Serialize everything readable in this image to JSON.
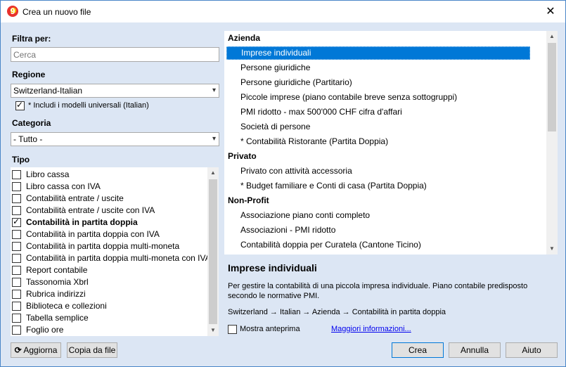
{
  "window": {
    "title": "Crea un nuovo file",
    "close_glyph": "✕"
  },
  "filter": {
    "label": "Filtra per:",
    "placeholder": "Cerca"
  },
  "region": {
    "label": "Regione",
    "selected": "Switzerland-Italian",
    "include_universal": "* Includi i modelli universali (Italian)",
    "include_universal_checked": true
  },
  "category": {
    "label": "Categoria",
    "selected": "- Tutto -"
  },
  "type": {
    "label": "Tipo",
    "items": [
      {
        "label": "Libro cassa",
        "checked": false
      },
      {
        "label": "Libro cassa con IVA",
        "checked": false
      },
      {
        "label": "Contabilità entrate / uscite",
        "checked": false
      },
      {
        "label": "Contabilità entrate / uscite con IVA",
        "checked": false
      },
      {
        "label": "Contabilità in partita doppia",
        "checked": true
      },
      {
        "label": "Contabilità in partita doppia con IVA",
        "checked": false
      },
      {
        "label": "Contabilità in partita doppia multi-moneta",
        "checked": false
      },
      {
        "label": "Contabilità in partita doppia multi-moneta con IVA",
        "checked": false
      },
      {
        "label": "Report contabile",
        "checked": false
      },
      {
        "label": "Tassonomia Xbrl",
        "checked": false
      },
      {
        "label": "Rubrica indirizzi",
        "checked": false
      },
      {
        "label": "Biblioteca e collezioni",
        "checked": false
      },
      {
        "label": "Tabella semplice",
        "checked": false
      },
      {
        "label": "Foglio ore",
        "checked": false
      }
    ]
  },
  "templates": {
    "rows": [
      {
        "kind": "group",
        "label": "Azienda"
      },
      {
        "kind": "item",
        "label": "Imprese individuali",
        "selected": true
      },
      {
        "kind": "item",
        "label": "Persone giuridiche"
      },
      {
        "kind": "item",
        "label": "Persone giuridiche (Partitario)"
      },
      {
        "kind": "item",
        "label": "Piccole imprese (piano contabile breve senza sottogruppi)"
      },
      {
        "kind": "item",
        "label": "PMI ridotto - max 500'000 CHF cifra d'affari"
      },
      {
        "kind": "item",
        "label": "Società di persone"
      },
      {
        "kind": "item",
        "label": "* Contabilità Ristorante (Partita Doppia)"
      },
      {
        "kind": "group",
        "label": "Privato"
      },
      {
        "kind": "item",
        "label": "Privato con attività accessoria"
      },
      {
        "kind": "item",
        "label": "* Budget familiare e Conti di casa (Partita Doppia)"
      },
      {
        "kind": "group",
        "label": "Non-Profit"
      },
      {
        "kind": "item",
        "label": "Associazione piano conti completo"
      },
      {
        "kind": "item",
        "label": "Associazioni - PMI ridotto"
      },
      {
        "kind": "item",
        "label": "Contabilità doppia per Curatela  (Cantone Ticino)"
      }
    ]
  },
  "description": {
    "title": "Imprese individuali",
    "text": "Per gestire la contabilità di una piccola impresa individuale. Piano contabile predisposto secondo le normative PMI.",
    "path": "Switzerland → Italian → Azienda → Contabilità in partita doppia",
    "show_preview": "Mostra anteprima",
    "more_info": "Maggiori informazioni..."
  },
  "buttons": {
    "refresh": "Aggiorna",
    "copy_from_file": "Copia da file",
    "create": "Crea",
    "cancel": "Annulla",
    "help": "Aiuto"
  },
  "colors": {
    "selection": "#0078d7",
    "dialog_bg": "#dce6f4",
    "link": "#0000ee"
  }
}
